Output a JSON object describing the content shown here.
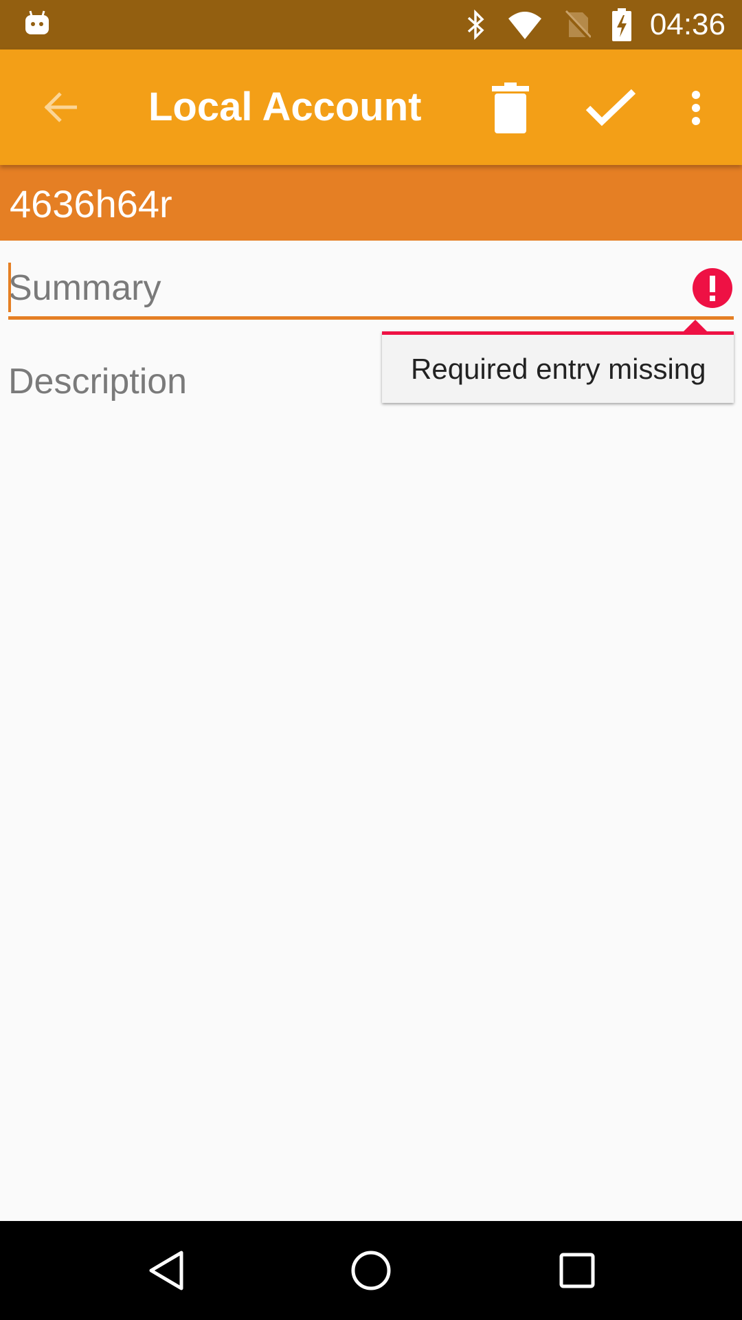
{
  "status_bar": {
    "time": "04:36",
    "icons": [
      "android-icon",
      "bluetooth-icon",
      "wifi-icon",
      "no-sim-icon",
      "battery-charging-icon"
    ]
  },
  "app_bar": {
    "title": "Local Account",
    "back_icon": "arrow-back-icon",
    "actions": [
      "delete-icon",
      "check-icon",
      "more-vert-icon"
    ]
  },
  "account_banner": {
    "account_name": "4636h64r"
  },
  "form": {
    "summary": {
      "value": "",
      "placeholder": "Summary",
      "has_error": true
    },
    "description": {
      "value": "",
      "placeholder": "Description"
    }
  },
  "error_popup": {
    "message": "Required entry missing"
  },
  "colors": {
    "status_bar": "#935f10",
    "app_bar": "#f39f17",
    "account_banner": "#e57f24",
    "accent": "#e57f24",
    "error": "#ee1144",
    "background": "#fafafa"
  },
  "nav_bar": {
    "buttons": [
      "nav-back-icon",
      "nav-home-icon",
      "nav-recents-icon"
    ]
  }
}
